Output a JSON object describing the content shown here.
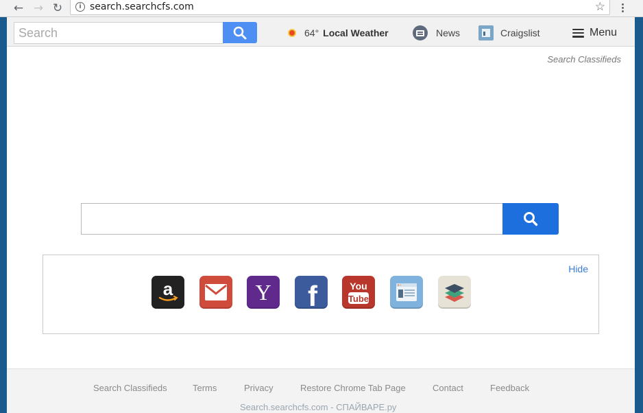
{
  "browser": {
    "url": "search.searchcfs.com"
  },
  "topbar": {
    "search_placeholder": "Search",
    "weather": {
      "temp": "64°",
      "label": "Local Weather"
    },
    "news_label": "News",
    "craigslist_label": "Craigslist",
    "menu_label": "Menu"
  },
  "classifieds_link": "Search Classifieds",
  "main_search": {
    "value": ""
  },
  "tiles": {
    "hide_label": "Hide",
    "items": [
      "amazon-icon",
      "gmail-icon",
      "yahoo-icon",
      "facebook-icon",
      "youtube-icon",
      "news-icon",
      "layers-icon"
    ],
    "youtube_text": [
      "You",
      "Tube"
    ],
    "yahoo_letter": "Y",
    "facebook_letter": "f",
    "amazon_letter": "a"
  },
  "footer": {
    "links": [
      "Search Classifieds",
      "Terms",
      "Privacy",
      "Restore Chrome Tab Page",
      "Contact",
      "Feedback"
    ],
    "copyright": "Search.searchcfs.com - СПАЙВАРЕ.ру"
  },
  "colors": {
    "search_button": "#4d8ff2",
    "main_search_button": "#1d6fde",
    "link_blue": "#3a7bd5"
  }
}
